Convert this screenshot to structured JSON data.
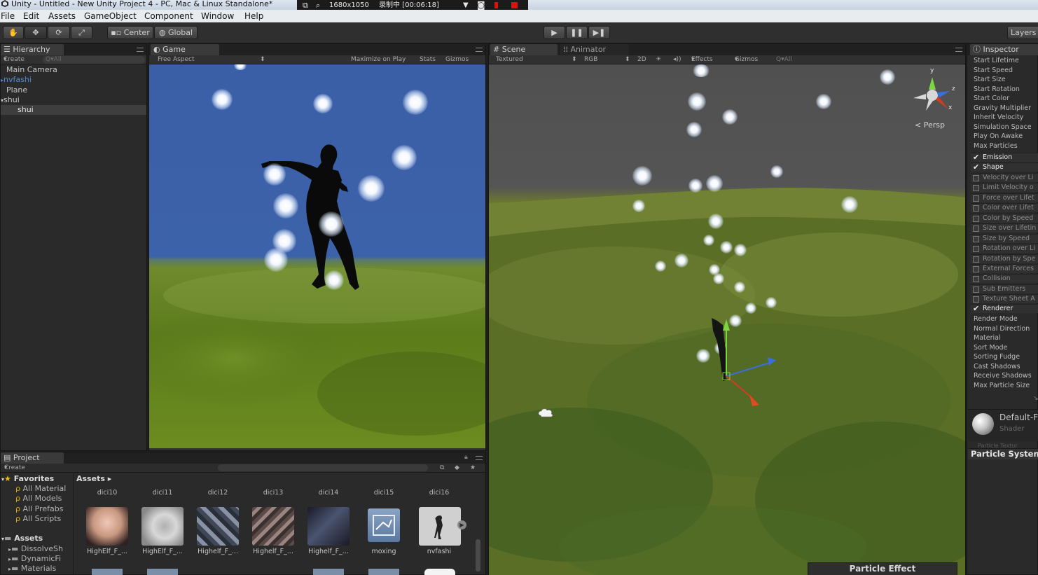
{
  "window": {
    "title": "Unity - Untitled - New Unity Project 4 - PC, Mac & Linux Standalone*"
  },
  "recorder": {
    "resolution": "1680x1050",
    "status": "录制中 [00:06:18]"
  },
  "menu": {
    "file": "File",
    "edit": "Edit",
    "assets": "Assets",
    "gameobject": "GameObject",
    "component": "Component",
    "window": "Window",
    "help": "Help"
  },
  "toolbar": {
    "center_label": "Center",
    "global_label": "Global",
    "layers_label": "Layers"
  },
  "hierarchy": {
    "tab": "Hierarchy",
    "create": "Create",
    "search_placeholder": "Q▾All",
    "items": [
      "Main Camera",
      "nvfashi",
      "Plane",
      "shui",
      "shui"
    ]
  },
  "game": {
    "tab": "Game",
    "aspect": "Free Aspect",
    "maximize": "Maximize on Play",
    "stats": "Stats",
    "gizmos": "Gizmos"
  },
  "scene": {
    "tab": "Scene",
    "tab2": "Animator",
    "render_mode": "Textured",
    "channel": "RGB",
    "mode_2d": "2D",
    "effects": "Effects",
    "gizmos": "Gizmos",
    "search_placeholder": "Q▾All",
    "persp": "Persp",
    "axis_y": "y",
    "axis_z": "z",
    "axis_x": "x",
    "overlay_title": "Particle Effect"
  },
  "inspector": {
    "tab": "Inspector",
    "props": [
      "Start Lifetime",
      "Start Speed",
      "Start Size",
      "Start Rotation",
      "Start Color",
      "Gravity Multiplier",
      "Inherit Velocity",
      "Simulation Space",
      "Play On Awake",
      "Max Particles"
    ],
    "modules": [
      {
        "label": "Emission",
        "checked": true
      },
      {
        "label": "Shape",
        "checked": true
      },
      {
        "label": "Velocity over Li",
        "checked": false
      },
      {
        "label": "Limit Velocity o",
        "checked": false
      },
      {
        "label": "Force over Lifet",
        "checked": false
      },
      {
        "label": "Color over Lifet",
        "checked": false
      },
      {
        "label": "Color by Speed",
        "checked": false
      },
      {
        "label": "Size over Lifetin",
        "checked": false
      },
      {
        "label": "Size by Speed",
        "checked": false
      },
      {
        "label": "Rotation over Li",
        "checked": false
      },
      {
        "label": "Rotation by Spe",
        "checked": false
      },
      {
        "label": "External Forces",
        "checked": false
      },
      {
        "label": "Collision",
        "checked": false
      },
      {
        "label": "Sub Emitters",
        "checked": false
      },
      {
        "label": "Texture Sheet A",
        "checked": false
      },
      {
        "label": "Renderer",
        "checked": true
      }
    ],
    "renderer_props": [
      "Render Mode",
      "Normal Direction",
      "Material",
      "Sort Mode",
      "Sorting Fudge",
      "Cast Shadows",
      "Receive Shadows",
      "Max Particle Size"
    ],
    "material_name": "Default-F",
    "material_shader": "Shader",
    "material_faded": "Particle Textur",
    "footer": "Particle Systen"
  },
  "project": {
    "tab": "Project",
    "create": "Create",
    "favorites_label": "Favorites",
    "favorites": [
      "All Material",
      "All Models",
      "All Prefabs",
      "All Scripts"
    ],
    "assets_label": "Assets",
    "asset_folders": [
      "DissolveSh",
      "DynamicFi",
      "Materials"
    ],
    "breadcrumb": "Assets",
    "row_top": [
      "dici10",
      "dici11",
      "dici12",
      "dici13",
      "dici14",
      "dici15",
      "dici16"
    ],
    "thumbs": [
      "HighElf_F_...",
      "HighElf_F_...",
      "Highelf_F_...",
      "Highelf_F_...",
      "Highelf_F_...",
      "moxing",
      "nvfashi"
    ]
  }
}
